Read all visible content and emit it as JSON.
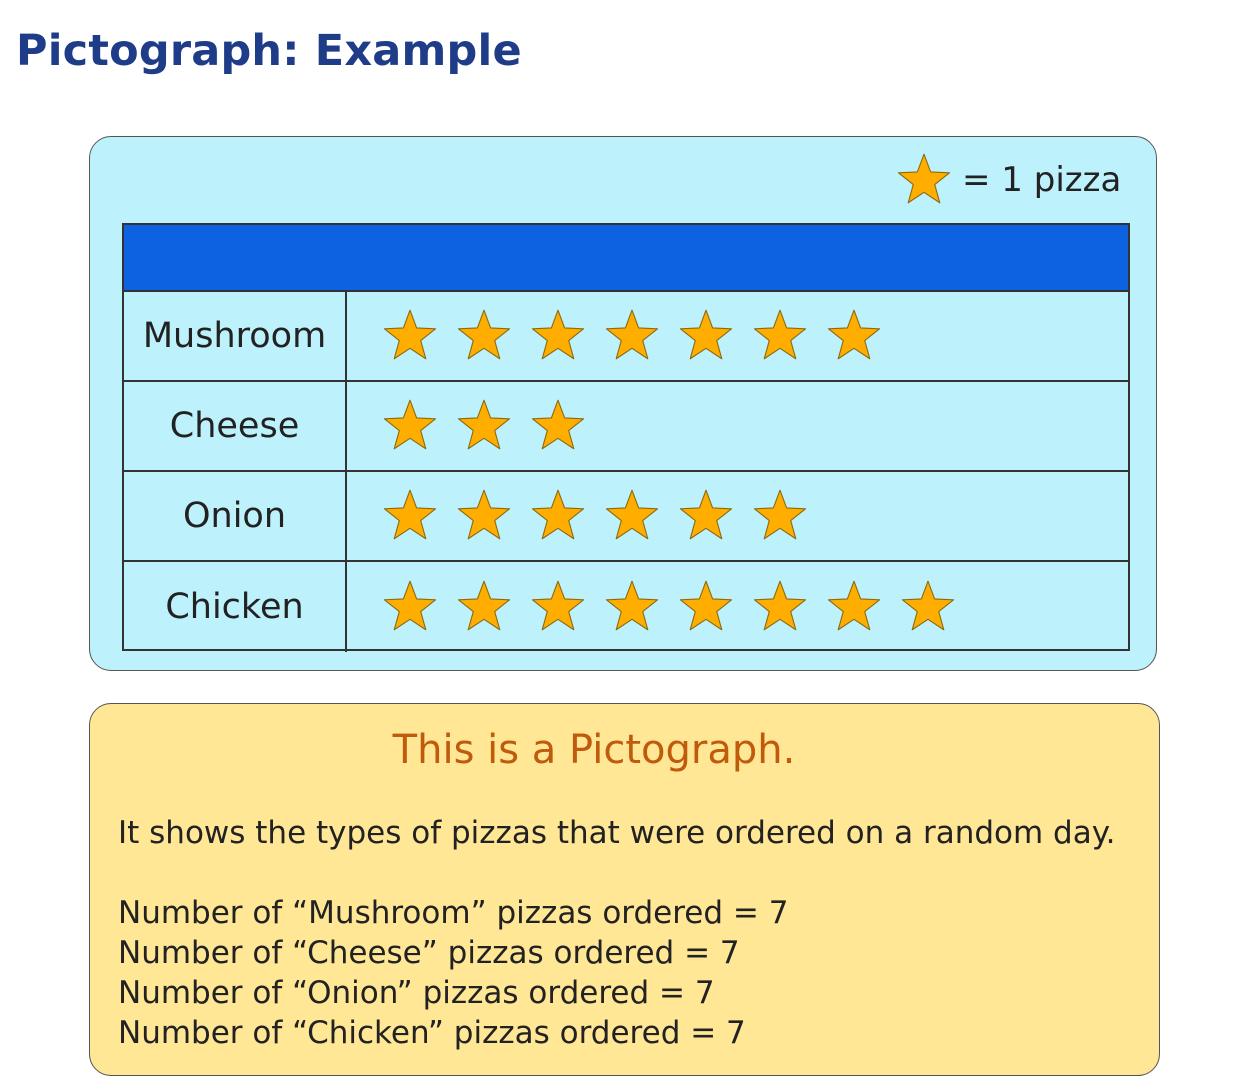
{
  "title": "Pictograph: Example",
  "key": {
    "icon": "star-icon",
    "label": "= 1 pizza",
    "value": 1
  },
  "chart_data": {
    "type": "pictograph",
    "icon": "star",
    "icon_color": "#ffae00",
    "header_color": "#0c62e0",
    "categories": [
      "Mushroom",
      "Cheese",
      "Onion",
      "Chicken"
    ],
    "values": [
      7,
      3,
      6,
      8
    ]
  },
  "info": {
    "title": "This is a Pictograph.",
    "description": "It shows the types of pizzas that were ordered on a random day.",
    "lines": [
      "Number of “Mushroom” pizzas ordered = 7",
      "Number of “Cheese” pizzas ordered = 7",
      "Number of “Onion” pizzas ordered = 7",
      "Number of “Chicken” pizzas ordered = 7"
    ]
  },
  "colors": {
    "chart_panel": "#bdf2fc",
    "info_panel": "#ffe795",
    "title": "#1f3c88",
    "info_title": "#c05a0c"
  }
}
